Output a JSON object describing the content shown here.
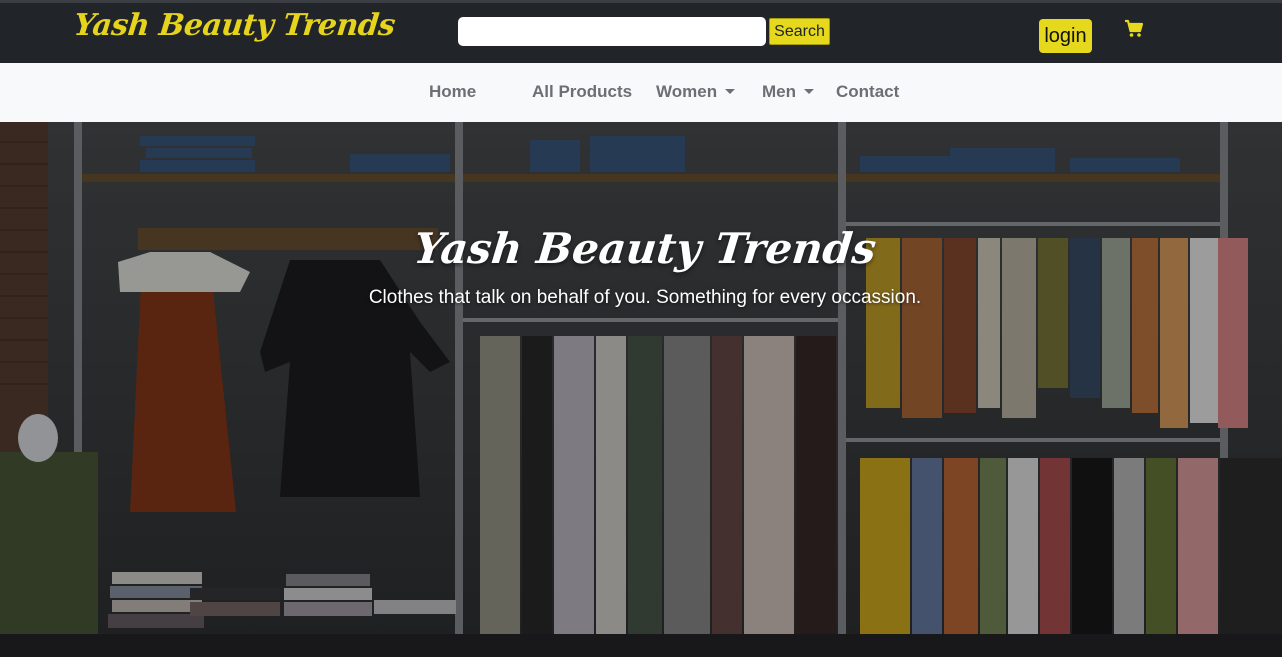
{
  "header": {
    "brand": "Yash Beauty Trends",
    "search": {
      "value": "",
      "placeholder": "",
      "button_label": "Search"
    },
    "login_label": "login",
    "cart_icon": "cart-icon"
  },
  "nav": {
    "items": [
      {
        "label": "Home"
      },
      {
        "label": "All Products"
      },
      {
        "label": "Women",
        "dropdown": true
      },
      {
        "label": "Men",
        "dropdown": true
      },
      {
        "label": "Contact"
      }
    ]
  },
  "hero": {
    "title": "Yash Beauty Trends",
    "subtitle": "Clothes that talk on behalf of you. Something for every occassion."
  },
  "colors": {
    "accent": "#e6d81c",
    "topbar": "#212529",
    "navbar": "#f8f9fa"
  }
}
